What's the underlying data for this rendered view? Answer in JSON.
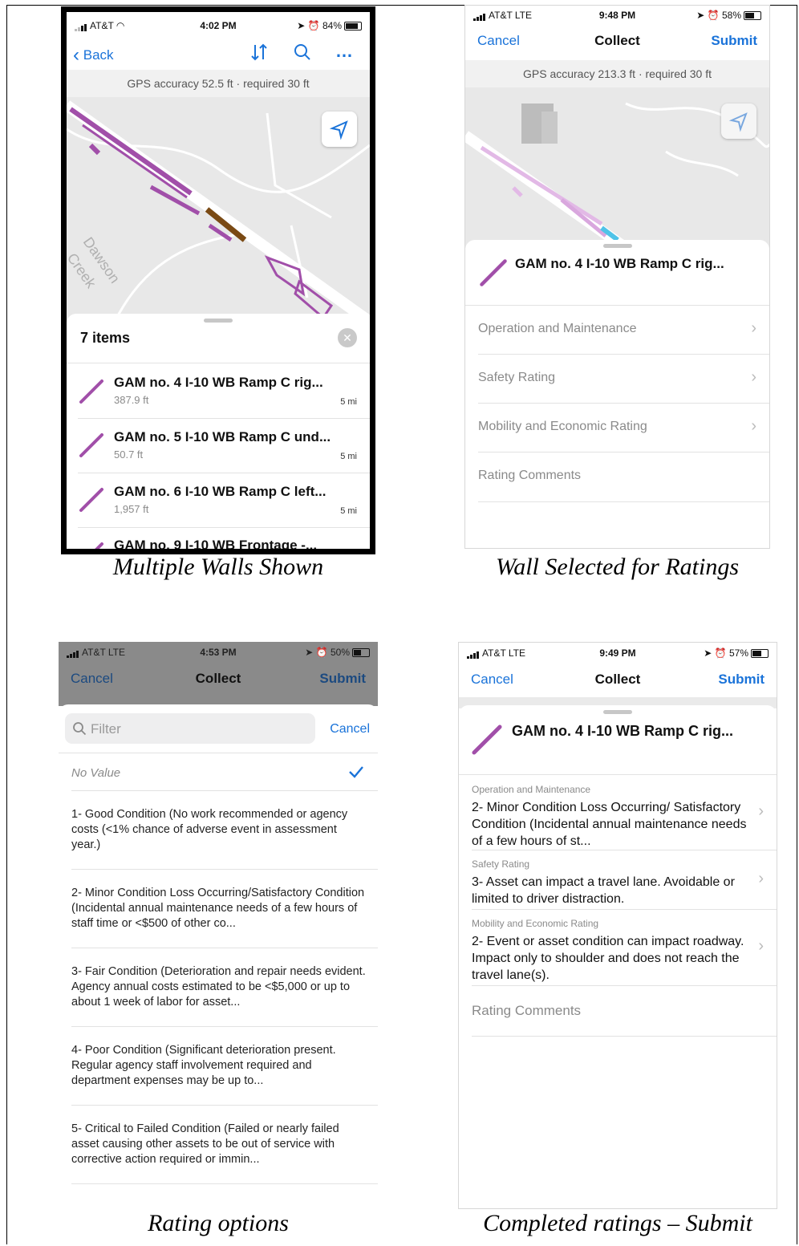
{
  "colors": {
    "accent": "#1a73d9",
    "feature": "#a14fa9",
    "selected": "#7a4a14",
    "highlight": "#4fc3e8"
  },
  "panel1": {
    "status": {
      "carrier": "AT&T",
      "time": "4:02 PM",
      "battery": "84%"
    },
    "nav": {
      "back": "Back",
      "sort_icon": "sort-icon",
      "search_icon": "search-icon",
      "more_icon": "more-icon"
    },
    "gps": "GPS accuracy 52.5 ft · required 30 ft",
    "map_labels": {
      "creek": "Dawson Creek"
    },
    "sheet": {
      "count": "7 items"
    },
    "items": [
      {
        "title": "GAM no. 4  I-10 WB Ramp C rig...",
        "sub": "387.9 ft",
        "dist": "5 mi"
      },
      {
        "title": "GAM no. 5  I-10 WB Ramp C und...",
        "sub": "50.7 ft",
        "dist": "5 mi"
      },
      {
        "title": "GAM no. 6  I-10 WB Ramp C left...",
        "sub": "1,957 ft",
        "dist": "5 mi"
      },
      {
        "title": "GAM no. 9  I-10 WB Frontage -...",
        "sub": "",
        "dist": ""
      }
    ],
    "caption": "Multiple Walls Shown"
  },
  "panel2": {
    "status": {
      "carrier": "AT&T  LTE",
      "time": "9:48 PM",
      "battery": "58%"
    },
    "nav": {
      "cancel": "Cancel",
      "title": "Collect",
      "submit": "Submit"
    },
    "gps": "GPS accuracy 213.3 ft · required 30 ft",
    "feature": "GAM no. 4  I-10 WB Ramp C rig...",
    "fields": [
      "Operation and Maintenance",
      "Safety Rating",
      "Mobility and Economic Rating",
      "Rating Comments"
    ],
    "caption": "Wall Selected for Ratings"
  },
  "panel3": {
    "status": {
      "carrier": "AT&T  LTE",
      "time": "4:53 PM",
      "battery": "50%"
    },
    "nav": {
      "cancel": "Cancel",
      "title": "Collect",
      "submit": "Submit"
    },
    "filter": {
      "placeholder": "Filter",
      "cancel": "Cancel"
    },
    "no_value": "No Value",
    "options": [
      "1- Good Condition (No work recommended or agency costs (<1% chance of adverse event in assessment year.)",
      "2- Minor Condition Loss Occurring/Satisfactory Condition (Incidental annual maintenance needs of a few hours of staff time or <$500 of other co...",
      "3- Fair Condition (Deterioration and repair needs evident. Agency annual costs estimated to be <$5,000 or up to about 1 week of labor for asset...",
      "4- Poor Condition (Significant deterioration present. Regular agency staff involvement required and department expenses may be up to...",
      "5- Critical to Failed Condition (Failed or nearly failed asset causing other assets to be out of service with corrective action required or immin..."
    ],
    "caption": "Rating options"
  },
  "panel4": {
    "status": {
      "carrier": "AT&T  LTE",
      "time": "9:49 PM",
      "battery": "57%"
    },
    "nav": {
      "cancel": "Cancel",
      "title": "Collect",
      "submit": "Submit"
    },
    "feature": "GAM no. 4  I-10 WB Ramp C rig...",
    "fields": [
      {
        "label": "Operation and Maintenance",
        "value": "2- Minor Condition Loss Occurring/ Satisfactory Condition (Incidental annual maintenance needs of a few hours of st..."
      },
      {
        "label": "Safety Rating",
        "value": "3- Asset can impact a travel lane. Avoidable or limited to driver distraction."
      },
      {
        "label": "Mobility and Economic Rating",
        "value": "2- Event or asset condition can impact roadway. Impact only to shoulder and does not reach the travel lane(s)."
      }
    ],
    "comments": "Rating Comments",
    "caption": "Completed ratings – Submit"
  }
}
